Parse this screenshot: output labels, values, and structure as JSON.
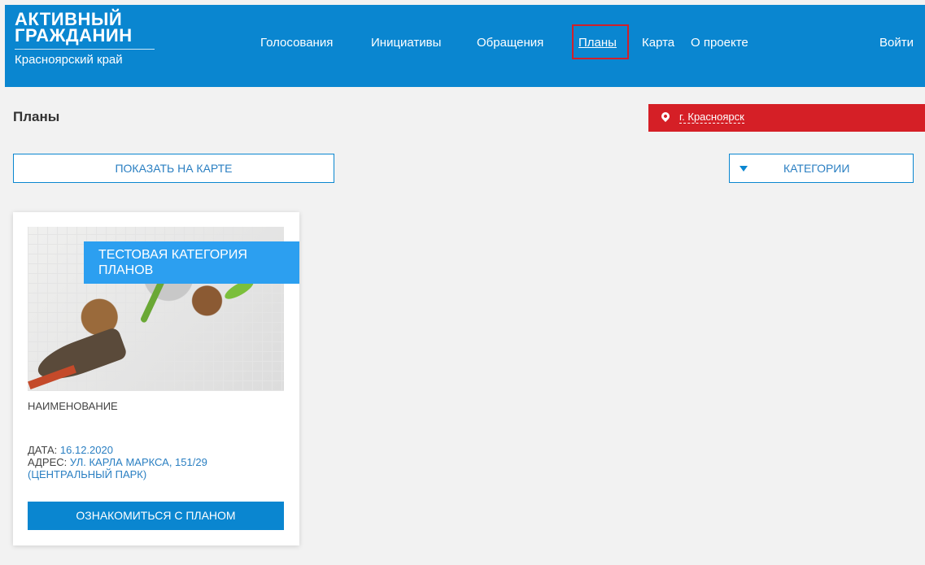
{
  "header": {
    "logo_line1": "АКТИВНЫЙ",
    "logo_line2": "ГРАЖДАНИН",
    "logo_region": "Красноярский край",
    "nav": [
      "Голосования",
      "Инициативы",
      "Обращения",
      "Планы",
      "Карта",
      "О проекте"
    ],
    "active_nav": "Планы",
    "login": "Войти"
  },
  "page": {
    "title": "Планы",
    "city": "г. Красноярск",
    "show_map": "ПОКАЗАТЬ НА КАРТЕ",
    "categories": "КАТЕГОРИИ"
  },
  "card": {
    "category": "ТЕСТОВАЯ КАТЕГОРИЯ ПЛАНОВ",
    "name": "НАИМЕНОВАНИЕ",
    "date_label": "ДАТА:",
    "date_value": "16.12.2020",
    "address_label": "АДРЕС:",
    "address_value": "УЛ. КАРЛА МАРКСА, 151/29 (ЦЕНТРАЛЬНЫЙ ПАРК)",
    "button": "ОЗНАКОМИТЬСЯ С ПЛАНОМ"
  },
  "colors": {
    "header_bg": "#0a86d0",
    "city_bar": "#d51f26",
    "badge": "#2c9ff0",
    "highlight": "#d0202a"
  },
  "icons": [
    "location-pin-icon",
    "triangle-down-icon"
  ]
}
